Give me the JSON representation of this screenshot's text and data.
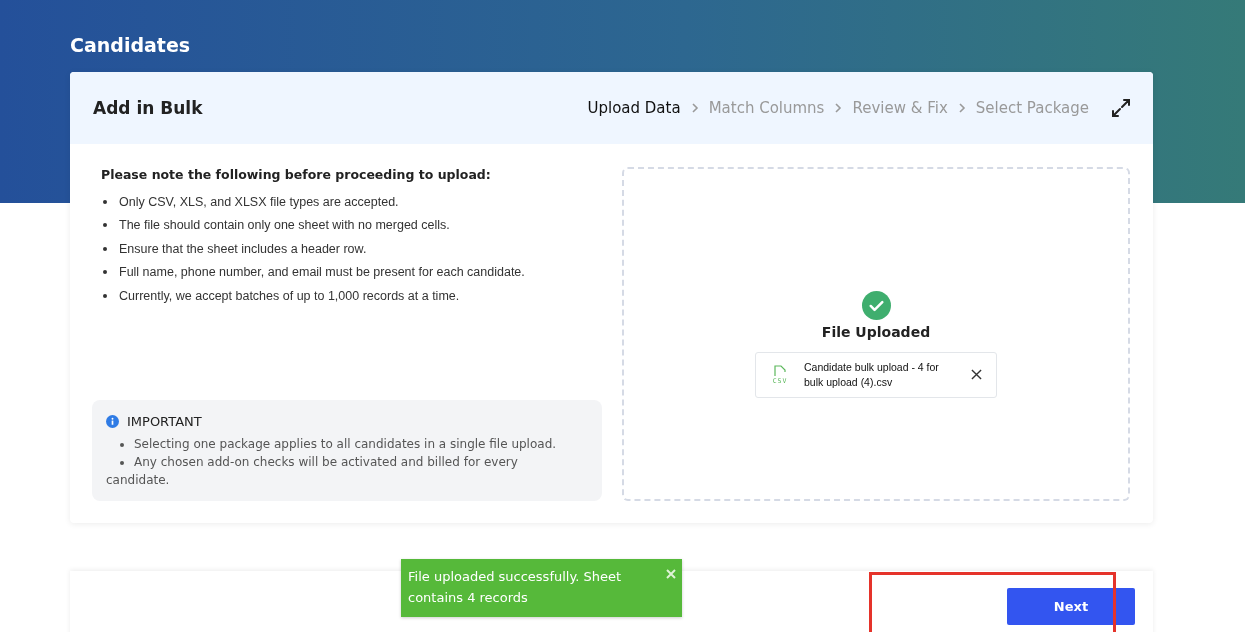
{
  "page_title": "Candidates",
  "card": {
    "title": "Add in Bulk",
    "steps": [
      {
        "label": "Upload Data",
        "selected": true
      },
      {
        "label": "Match Columns",
        "selected": false
      },
      {
        "label": "Review & Fix",
        "selected": false
      },
      {
        "label": "Select Package",
        "selected": false
      }
    ]
  },
  "notes": {
    "heading": "Please note the following before proceeding to upload:",
    "items": [
      "Only CSV, XLS, and XLSX file types are accepted.",
      "The file should contain only one sheet with no merged cells.",
      "Ensure that the sheet includes a header row.",
      "Full name, phone number, and email must be present for each candidate.",
      "Currently, we accept batches of up to 1,000 records at a time."
    ]
  },
  "important": {
    "title": "IMPORTANT",
    "items": [
      "Selecting one package applies to all candidates in a single file upload.",
      "Any chosen add-on checks will be activated and billed for every candidate."
    ]
  },
  "upload": {
    "status": "File Uploaded",
    "file_type": "CSV",
    "file_name": "Candidate bulk upload - 4 for bulk upload (4).csv"
  },
  "toast": {
    "message": "File uploaded successfully. Sheet contains 4 records"
  },
  "next_button": "Next"
}
